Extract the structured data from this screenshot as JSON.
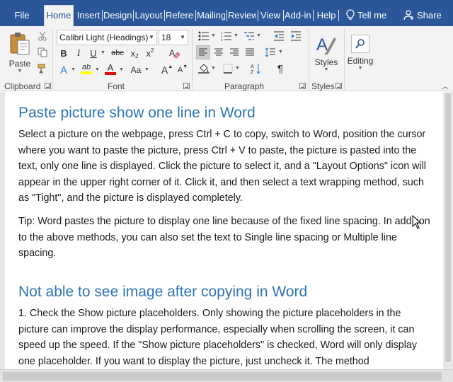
{
  "tabs": [
    "File",
    "Home",
    "Insert",
    "Design",
    "Layout",
    "References",
    "Mailings",
    "Review",
    "View",
    "Add-ins",
    "Help"
  ],
  "active_tab": "Home",
  "tell_me": "Tell me",
  "share": "Share",
  "ribbon": {
    "clipboard": {
      "label": "Clipboard",
      "paste": "Paste"
    },
    "font": {
      "label": "Font",
      "name": "Calibri Light (Headings)",
      "size": "18",
      "bold": "B",
      "italic": "I",
      "underline": "U",
      "strike": "abc",
      "subscript": "x",
      "superscript": "x",
      "grow": "A",
      "shrink": "A",
      "case": "Aa",
      "effects": "A",
      "fontcolor": "A",
      "highlight": "ab"
    },
    "paragraph": {
      "label": "Paragraph",
      "pilcrow": "¶"
    },
    "styles": {
      "label": "Styles",
      "button": "Styles"
    },
    "editing": {
      "button": "Editing"
    }
  },
  "document": {
    "heading1": "Paste picture show one line in Word",
    "para1": "Select a picture on the webpage, press Ctrl + C to copy, switch to Word, position the cursor where you want to paste the picture, press Ctrl + V to paste, the picture is pasted into the text, only one line is displayed. Click the picture to select it, and a \"Layout Options\" icon will appear in the upper right corner of it. Click it, and then select a text wrapping method, such as \"Tight\", and the picture is displayed completely.",
    "para2": "Tip: Word pastes the picture to display one line because of the fixed line spacing. In addition to the above methods, you can also set the text to Single line spacing or Multiple line spacing.",
    "heading2": "Not able to see image after copying in Word",
    "para3": "1. Check the Show picture placeholders. Only showing the picture placeholders in the picture can improve the display performance, especially when scrolling the screen, it can speed up the speed. If the \"Show picture placeholders\" is checked, Word will only display one placeholder. If you want to display the picture, just uncheck it. The method"
  },
  "colors": {
    "titlebar": "#2b579a",
    "heading": "#2e74b5",
    "ribbon": "#f3f3f3"
  }
}
